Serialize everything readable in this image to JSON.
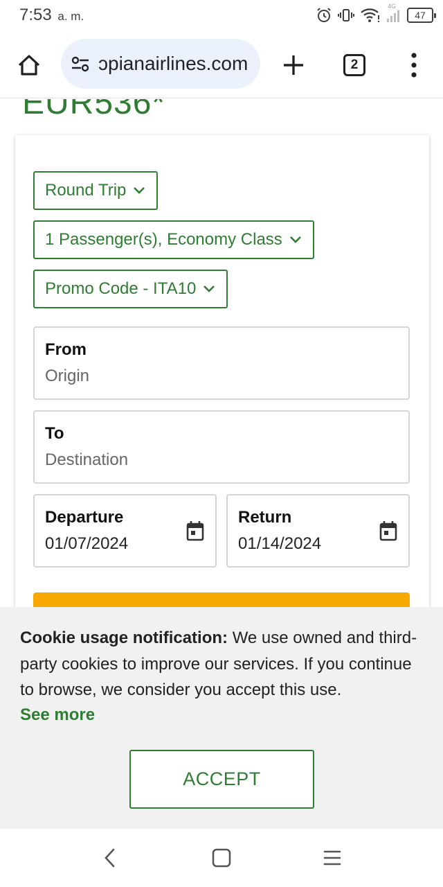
{
  "status_bar": {
    "time": "7:53",
    "ampm": "a. m.",
    "battery": "47",
    "network": "4G"
  },
  "browser": {
    "url": "ɔpianairlines.com",
    "tab_count": "2"
  },
  "page": {
    "price_heading": "EUR536*",
    "dropdowns": {
      "trip_type": "Round Trip",
      "passengers": "1 Passenger(s), Economy Class",
      "promo": "Promo Code - ITA10"
    },
    "from": {
      "label": "From",
      "placeholder": "Origin"
    },
    "to": {
      "label": "To",
      "placeholder": "Destination"
    },
    "departure": {
      "label": "Departure",
      "value": "01/07/2024"
    },
    "return": {
      "label": "Return",
      "value": "01/14/2024"
    },
    "colors": {
      "accent_green": "#2e7d32",
      "search_button": "#f7a900"
    }
  },
  "cookie_banner": {
    "title": "Cookie usage notification:",
    "body": " We use owned and third-party cookies to improve our services. If you continue to browse, we consider you accept this use.",
    "see_more": "See more",
    "accept": "ACCEPT"
  },
  "nav_bar": {
    "icons": [
      "back-icon",
      "home-square-icon",
      "recents-icon"
    ]
  }
}
